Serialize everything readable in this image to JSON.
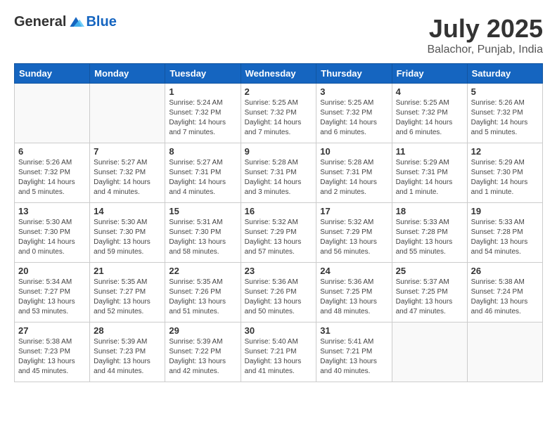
{
  "header": {
    "logo_general": "General",
    "logo_blue": "Blue",
    "month": "July 2025",
    "location": "Balachor, Punjab, India"
  },
  "days_of_week": [
    "Sunday",
    "Monday",
    "Tuesday",
    "Wednesday",
    "Thursday",
    "Friday",
    "Saturday"
  ],
  "weeks": [
    [
      {
        "day": "",
        "info": ""
      },
      {
        "day": "",
        "info": ""
      },
      {
        "day": "1",
        "info": "Sunrise: 5:24 AM\nSunset: 7:32 PM\nDaylight: 14 hours and 7 minutes."
      },
      {
        "day": "2",
        "info": "Sunrise: 5:25 AM\nSunset: 7:32 PM\nDaylight: 14 hours and 7 minutes."
      },
      {
        "day": "3",
        "info": "Sunrise: 5:25 AM\nSunset: 7:32 PM\nDaylight: 14 hours and 6 minutes."
      },
      {
        "day": "4",
        "info": "Sunrise: 5:25 AM\nSunset: 7:32 PM\nDaylight: 14 hours and 6 minutes."
      },
      {
        "day": "5",
        "info": "Sunrise: 5:26 AM\nSunset: 7:32 PM\nDaylight: 14 hours and 5 minutes."
      }
    ],
    [
      {
        "day": "6",
        "info": "Sunrise: 5:26 AM\nSunset: 7:32 PM\nDaylight: 14 hours and 5 minutes."
      },
      {
        "day": "7",
        "info": "Sunrise: 5:27 AM\nSunset: 7:32 PM\nDaylight: 14 hours and 4 minutes."
      },
      {
        "day": "8",
        "info": "Sunrise: 5:27 AM\nSunset: 7:31 PM\nDaylight: 14 hours and 4 minutes."
      },
      {
        "day": "9",
        "info": "Sunrise: 5:28 AM\nSunset: 7:31 PM\nDaylight: 14 hours and 3 minutes."
      },
      {
        "day": "10",
        "info": "Sunrise: 5:28 AM\nSunset: 7:31 PM\nDaylight: 14 hours and 2 minutes."
      },
      {
        "day": "11",
        "info": "Sunrise: 5:29 AM\nSunset: 7:31 PM\nDaylight: 14 hours and 1 minute."
      },
      {
        "day": "12",
        "info": "Sunrise: 5:29 AM\nSunset: 7:30 PM\nDaylight: 14 hours and 1 minute."
      }
    ],
    [
      {
        "day": "13",
        "info": "Sunrise: 5:30 AM\nSunset: 7:30 PM\nDaylight: 14 hours and 0 minutes."
      },
      {
        "day": "14",
        "info": "Sunrise: 5:30 AM\nSunset: 7:30 PM\nDaylight: 13 hours and 59 minutes."
      },
      {
        "day": "15",
        "info": "Sunrise: 5:31 AM\nSunset: 7:30 PM\nDaylight: 13 hours and 58 minutes."
      },
      {
        "day": "16",
        "info": "Sunrise: 5:32 AM\nSunset: 7:29 PM\nDaylight: 13 hours and 57 minutes."
      },
      {
        "day": "17",
        "info": "Sunrise: 5:32 AM\nSunset: 7:29 PM\nDaylight: 13 hours and 56 minutes."
      },
      {
        "day": "18",
        "info": "Sunrise: 5:33 AM\nSunset: 7:28 PM\nDaylight: 13 hours and 55 minutes."
      },
      {
        "day": "19",
        "info": "Sunrise: 5:33 AM\nSunset: 7:28 PM\nDaylight: 13 hours and 54 minutes."
      }
    ],
    [
      {
        "day": "20",
        "info": "Sunrise: 5:34 AM\nSunset: 7:27 PM\nDaylight: 13 hours and 53 minutes."
      },
      {
        "day": "21",
        "info": "Sunrise: 5:35 AM\nSunset: 7:27 PM\nDaylight: 13 hours and 52 minutes."
      },
      {
        "day": "22",
        "info": "Sunrise: 5:35 AM\nSunset: 7:26 PM\nDaylight: 13 hours and 51 minutes."
      },
      {
        "day": "23",
        "info": "Sunrise: 5:36 AM\nSunset: 7:26 PM\nDaylight: 13 hours and 50 minutes."
      },
      {
        "day": "24",
        "info": "Sunrise: 5:36 AM\nSunset: 7:25 PM\nDaylight: 13 hours and 48 minutes."
      },
      {
        "day": "25",
        "info": "Sunrise: 5:37 AM\nSunset: 7:25 PM\nDaylight: 13 hours and 47 minutes."
      },
      {
        "day": "26",
        "info": "Sunrise: 5:38 AM\nSunset: 7:24 PM\nDaylight: 13 hours and 46 minutes."
      }
    ],
    [
      {
        "day": "27",
        "info": "Sunrise: 5:38 AM\nSunset: 7:23 PM\nDaylight: 13 hours and 45 minutes."
      },
      {
        "day": "28",
        "info": "Sunrise: 5:39 AM\nSunset: 7:23 PM\nDaylight: 13 hours and 44 minutes."
      },
      {
        "day": "29",
        "info": "Sunrise: 5:39 AM\nSunset: 7:22 PM\nDaylight: 13 hours and 42 minutes."
      },
      {
        "day": "30",
        "info": "Sunrise: 5:40 AM\nSunset: 7:21 PM\nDaylight: 13 hours and 41 minutes."
      },
      {
        "day": "31",
        "info": "Sunrise: 5:41 AM\nSunset: 7:21 PM\nDaylight: 13 hours and 40 minutes."
      },
      {
        "day": "",
        "info": ""
      },
      {
        "day": "",
        "info": ""
      }
    ]
  ]
}
